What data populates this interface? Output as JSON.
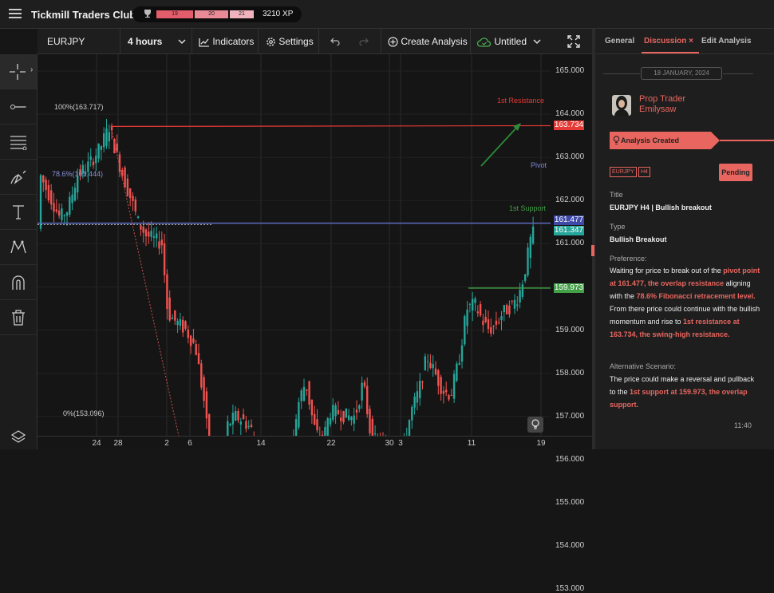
{
  "app": {
    "title": "Tickmill Traders Club"
  },
  "xp": {
    "seg1": "19",
    "seg2": "20",
    "seg3": "21",
    "label": "3210 XP"
  },
  "toolbar": {
    "symbol": "EURJPY",
    "timeframe": "4 hours",
    "indicators": "Indicators",
    "settings": "Settings",
    "create": "Create Analysis",
    "untitled": "Untitled"
  },
  "price_axis": [
    "165.000",
    "164.000",
    "163.000",
    "162.000",
    "161.000",
    "160.000",
    "159.000",
    "158.000",
    "157.000",
    "156.000",
    "155.000",
    "154.000",
    "153.000"
  ],
  "price_badges": {
    "resistance": "163.734",
    "pivot1": "161.477",
    "pivot2": "161.347",
    "support": "159.973"
  },
  "time_axis": [
    "24",
    "28",
    "2",
    "6",
    "14",
    "22",
    "30",
    "3",
    "11",
    "19"
  ],
  "chart_labels": {
    "fib100": "100%(163.717)",
    "fib786": "78.6%(161.444)",
    "fib0": "0%(153.096)",
    "resistance": "1st Resistance",
    "pivot": "Pivot",
    "support": "1st Support"
  },
  "panel": {
    "tabs": [
      "General",
      "Discussion",
      "Edit Analysis"
    ],
    "tab_close": "×",
    "date": "18 JANUARY, 2024",
    "user": {
      "line1": "Prop Trader",
      "line2": "Emilysaw"
    },
    "created": "Analysis Created",
    "tag1": "EURJPY",
    "tag2": "H4",
    "status": "Pending",
    "title_label": "Title",
    "title_value": "EURJPY H4 | Bullish breakout",
    "type_label": "Type",
    "type_value": "Bullish Breakout",
    "pref_label": "Preference:",
    "pref": [
      {
        "t": "Waiting for price to break out of the ",
        "h": false
      },
      {
        "t": "pivot point at 161.477, the overlap resistance",
        "h": true
      },
      {
        "t": " aligning with the ",
        "h": false
      },
      {
        "t": "78.6% Fibonacci retracement level.",
        "h": true
      },
      {
        "t": " From there price could continue with the bullish momentum and rise to ",
        "h": false
      },
      {
        "t": "1st resistance at 163.734, the swing-high resistance.",
        "h": true
      }
    ],
    "alt_label": "Alternative Scenario:",
    "alt": [
      {
        "t": "The price could make a reversal and pullback to the ",
        "h": false
      },
      {
        "t": "1st support at 159.973, the overlap support.",
        "h": true
      }
    ],
    "time": "11:40"
  },
  "colors": {
    "accent": "#e8665f",
    "up": "#26a69a",
    "down": "#ef5350",
    "resistance": "#e53935",
    "pivot": "#5c6bc0",
    "support": "#43a047"
  }
}
